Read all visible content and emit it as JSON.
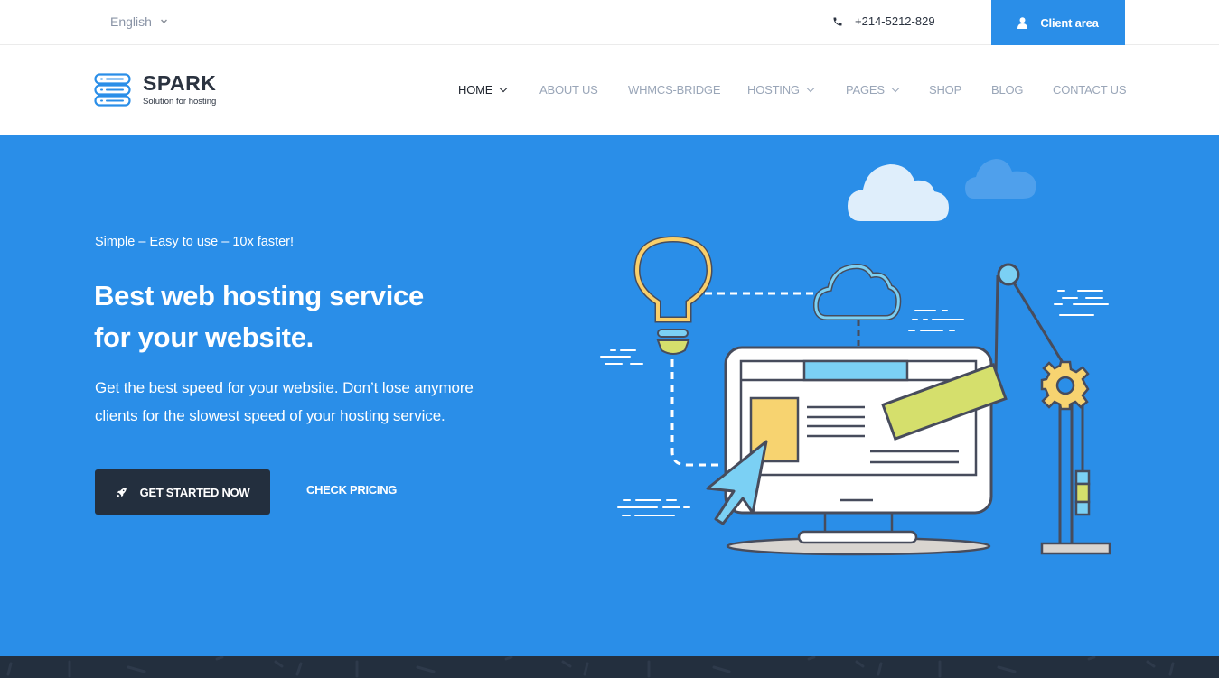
{
  "topbar": {
    "language": "English",
    "phone": "+214-5212-829",
    "client_area_label": "Client area"
  },
  "logo": {
    "name": "SPARK",
    "tagline": "Solution for hosting"
  },
  "nav": {
    "items": [
      {
        "label": "HOME",
        "active": true,
        "has_dropdown": true
      },
      {
        "label": "ABOUT US",
        "active": false,
        "has_dropdown": false
      },
      {
        "label": "WHMCS-BRIDGE",
        "active": false,
        "has_dropdown": false
      },
      {
        "label": "HOSTING",
        "active": false,
        "has_dropdown": true
      },
      {
        "label": "PAGES",
        "active": false,
        "has_dropdown": true
      },
      {
        "label": "SHOP",
        "active": false,
        "has_dropdown": false
      },
      {
        "label": "BLOG",
        "active": false,
        "has_dropdown": false
      },
      {
        "label": "CONTACT US",
        "active": false,
        "has_dropdown": false
      }
    ]
  },
  "hero": {
    "tagline": "Simple – Easy to use – 10x faster!",
    "headline_line1": "Best web hosting service",
    "headline_line2": "for your website.",
    "desc_line1": "Get the best speed for your website. Don’t lose anymore",
    "desc_line2": "clients for the slowest speed of your hosting service.",
    "cta_primary": "GET STARTED NOW",
    "cta_secondary": "CHECK PRICING"
  },
  "icons": {
    "language_dropdown": "chevron-down-icon",
    "phone": "phone-icon",
    "client": "user-icon",
    "logo": "server-stack-icon",
    "cta_primary": "rocket-icon"
  },
  "colors": {
    "brand_blue": "#2a8ee8",
    "dark_navy": "#232f3e",
    "nav_inactive": "#9aa6b8",
    "nav_active": "#20262f"
  }
}
